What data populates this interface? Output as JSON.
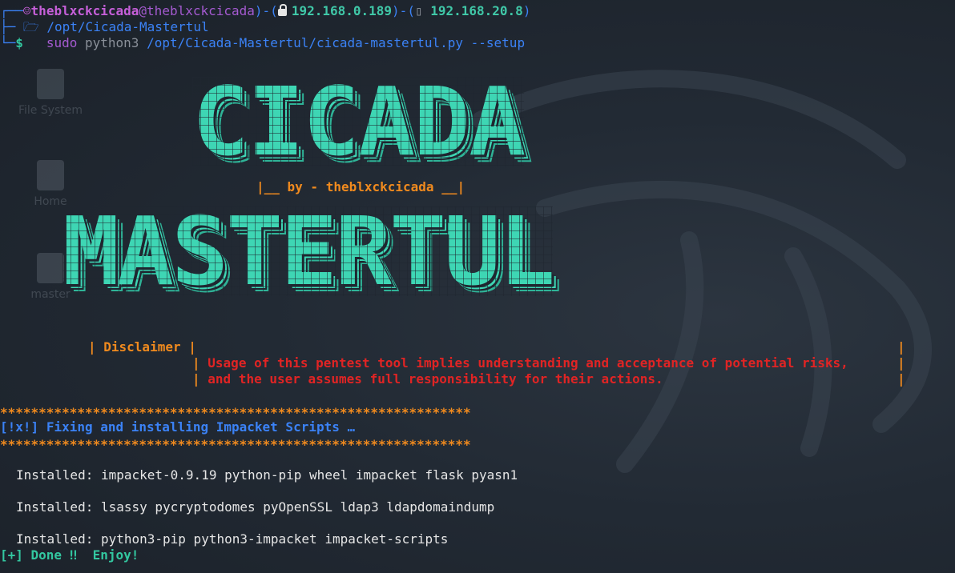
{
  "prompt": {
    "user": "theblxckcicada",
    "host": "theblxckcicada",
    "ip_vpn": "192.168.0.189",
    "ip_local": "192.168.20.8",
    "cwd": "/opt/Cicada-Mastertul",
    "symbol": "$",
    "cmd_sudo": "sudo",
    "cmd_bin": "python3",
    "cmd_args": "/opt/Cicada-Mastertul/cicada-mastertul.py --setup"
  },
  "desktop": {
    "icons": [
      "File System",
      "Home",
      "master"
    ]
  },
  "banner": {
    "title1": "CICADA",
    "byline": "|__ by - theblxckcicada __|",
    "title2": "MASTERTUL"
  },
  "disclaimer": {
    "label": "| Disclaimer |",
    "bar": "|",
    "line1": "Usage of this pentest tool implies understanding and acceptance of potential risks,",
    "line2": "and the user assumes full responsibility for their actions."
  },
  "output": {
    "stars": "*************************************************************",
    "fixing_prefix": "[!x!]",
    "fixing_text": "Fixing and installing Impacket Scripts",
    "ellipsis": "…",
    "installed1": "Installed: impacket-0.9.19 python-pip wheel impacket flask pyasn1",
    "installed2": "Installed: lsassy pycryptodomes pyOpenSSL ldap3 ldapdomaindump",
    "installed3": "Installed: python3-pip python3-impacket impacket-scripts",
    "done": "[+] Done",
    "bang": "‼",
    "enjoy": "Enjoy!"
  },
  "colors": {
    "background": "#1f2630",
    "banner": "#3ed6b4",
    "orange": "#f08a1e",
    "red": "#e02424",
    "blue": "#3b82f6"
  }
}
